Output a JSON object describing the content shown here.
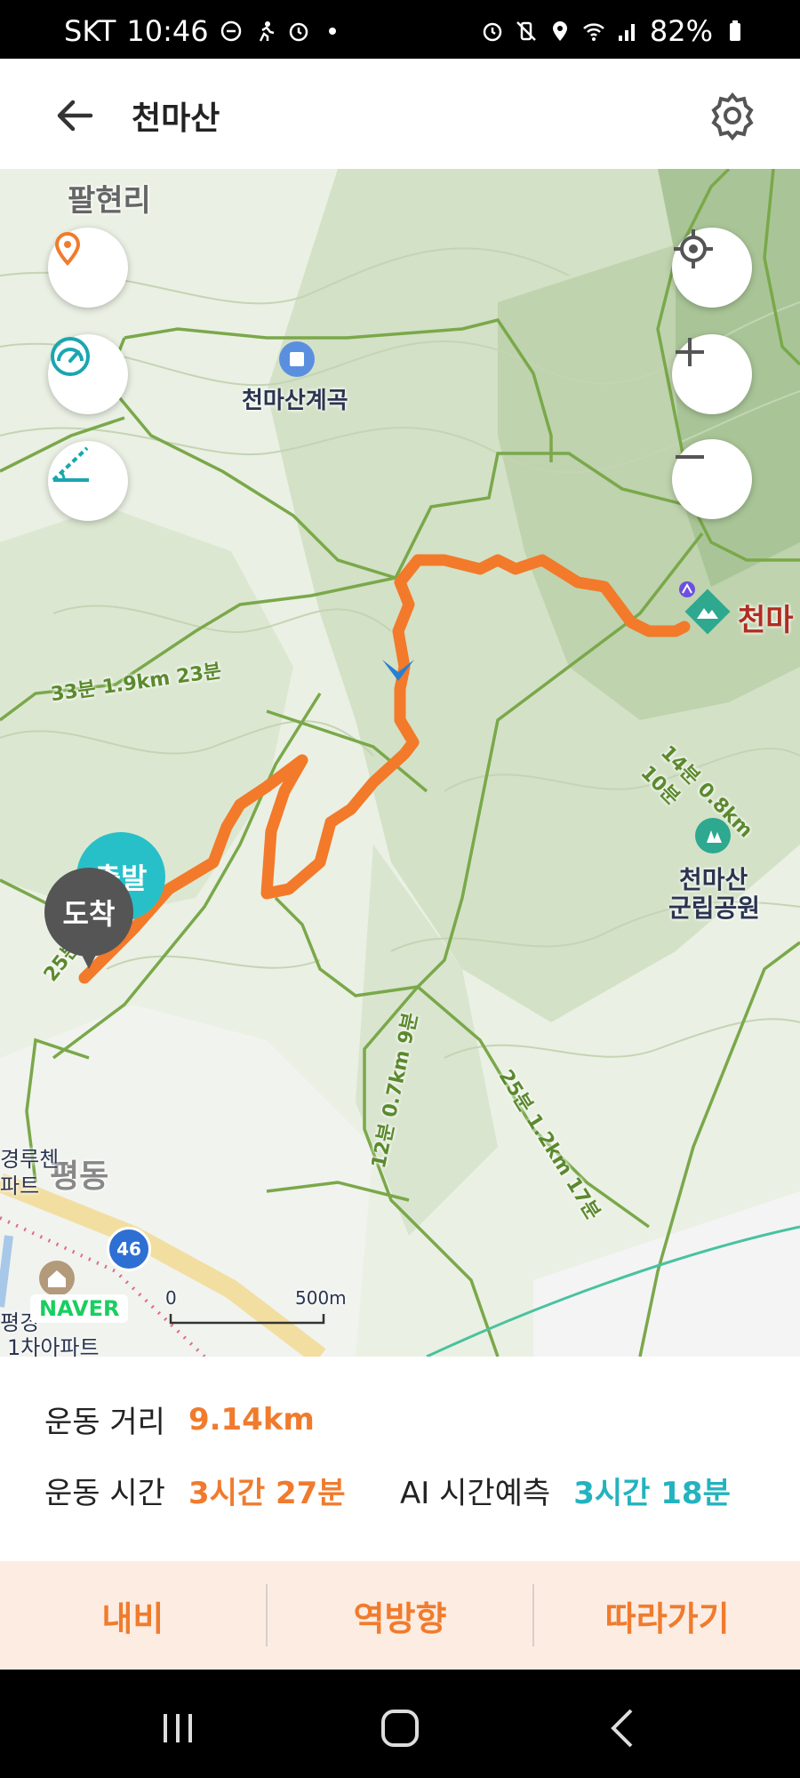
{
  "status_bar": {
    "carrier": "SKT",
    "time": "10:46",
    "battery": "82%",
    "icons": [
      "minus-circle-icon",
      "running-icon",
      "alarm-icon",
      "dot-icon",
      "alarm-icon",
      "vibrate-mute-icon",
      "location-icon",
      "wifi-icon",
      "signal-icon",
      "battery-icon"
    ]
  },
  "header": {
    "title": "천마산",
    "back_icon": "arrow-left-icon",
    "settings_icon": "gear-icon"
  },
  "map": {
    "labels": {
      "palhyeonri": "팔현리",
      "cheonmasan_valley": "천마산계곡",
      "cheonmasan_peak": "천마",
      "park_line1": "천마산",
      "park_line2": "군립공원",
      "pyeongdong": "평동",
      "apt1": "경루첸",
      "apt2": "파트",
      "apt3": "평경",
      "apt4": "1차아파트",
      "start": "출발",
      "end": "도착",
      "naver": "NAVER",
      "route_badge": "46",
      "trail_a": "33분 1.9km 23분",
      "trail_b": "14분 0.8km 10분",
      "trail_c": "25분 1.4km",
      "trail_d": "12분 0.7km 9분",
      "trail_e": "25분 1.2km 17분",
      "scale_zero": "0",
      "scale_max": "500m"
    },
    "buttons": {
      "location_pin": "location-pin-icon",
      "speed": "speedometer-icon",
      "slope": "slope-icon",
      "my_location": "crosshair-icon",
      "zoom_in": "plus-icon",
      "zoom_out": "minus-icon"
    }
  },
  "stats": {
    "distance_label": "운동 거리",
    "distance_value": "9.14km",
    "time_label": "운동 시간",
    "time_value": "3시간 27분",
    "ai_label": "AI 시간예측",
    "ai_value": "3시간 18분"
  },
  "actions": {
    "navi": "내비",
    "reverse": "역방향",
    "follow": "따라가기"
  },
  "colors": {
    "accent": "#f07b2d",
    "teal": "#23b3bf",
    "trail": "#7aa84a",
    "action_bg": "#fdece2"
  }
}
